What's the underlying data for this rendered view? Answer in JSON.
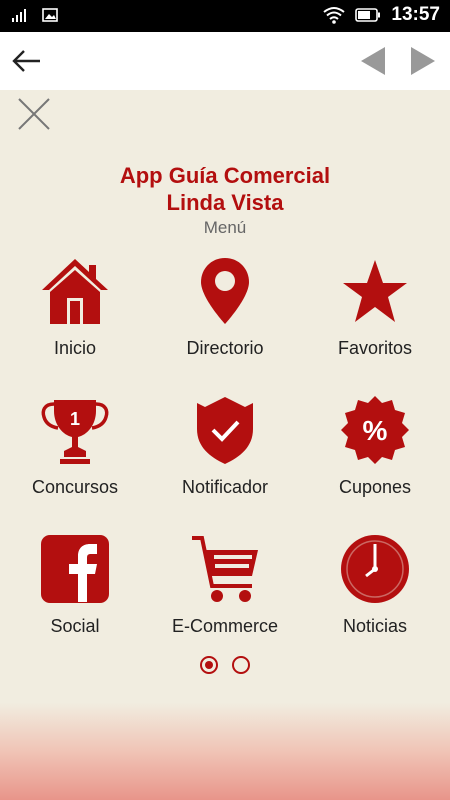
{
  "status_bar": {
    "time": "13:57"
  },
  "header": {
    "app_title_line1": "App Guía Comercial",
    "app_title_line2": "Linda Vista",
    "subtitle": "Menú"
  },
  "menu": {
    "items": [
      {
        "label": "Inicio",
        "icon": "home-icon"
      },
      {
        "label": "Directorio",
        "icon": "map-pin-icon"
      },
      {
        "label": "Favoritos",
        "icon": "star-icon"
      },
      {
        "label": "Concursos",
        "icon": "trophy-icon"
      },
      {
        "label": "Notificador",
        "icon": "shield-check-icon"
      },
      {
        "label": "Cupones",
        "icon": "percent-badge-icon"
      },
      {
        "label": "Social",
        "icon": "facebook-icon"
      },
      {
        "label": "E-Commerce",
        "icon": "shopping-cart-icon"
      },
      {
        "label": "Noticias",
        "icon": "clock-icon"
      }
    ]
  },
  "pager": {
    "pages": 2,
    "active": 1
  },
  "colors": {
    "accent": "#b30f0f",
    "background": "#f1ede0"
  }
}
